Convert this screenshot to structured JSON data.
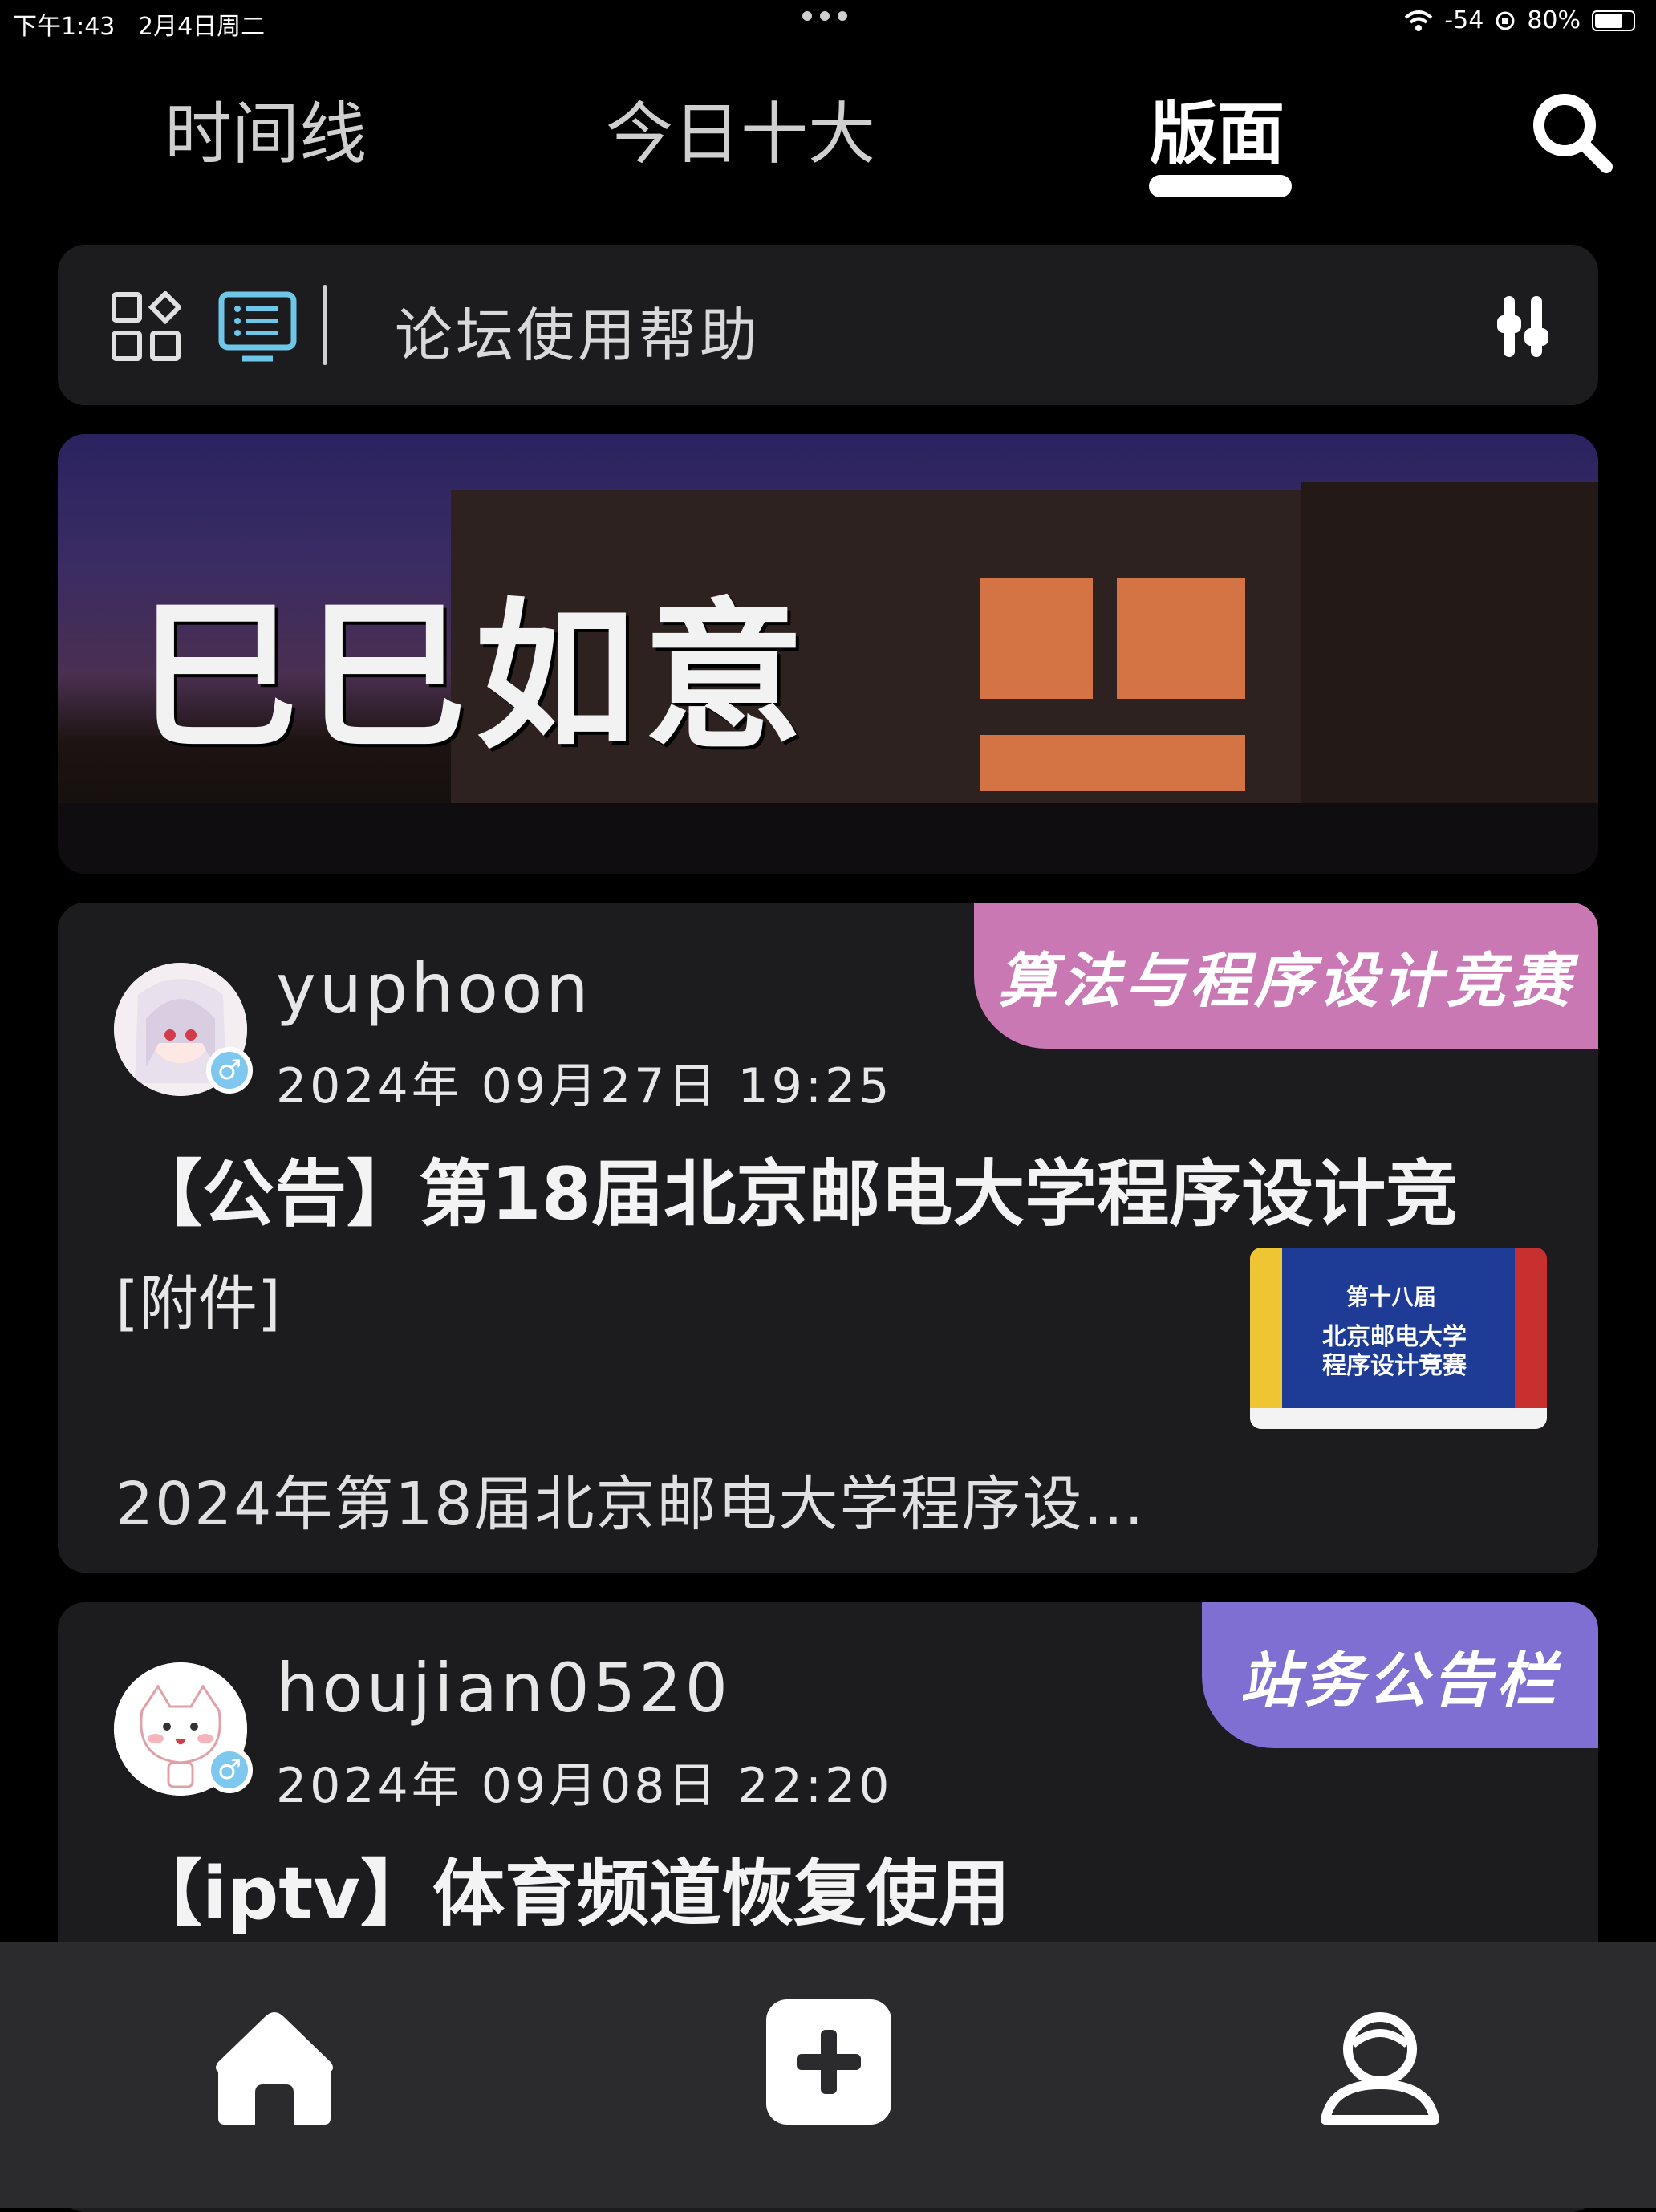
{
  "status_bar": {
    "time": "下午1:43",
    "date": "2月4日周二",
    "signal": "-54",
    "battery": "80%",
    "battery_level": 0.8
  },
  "tabs": [
    {
      "label": "时间线",
      "active": false
    },
    {
      "label": "今日十大",
      "active": false
    },
    {
      "label": "版面",
      "active": true
    }
  ],
  "board_bar": {
    "board_name": "论坛使用帮助",
    "icons": [
      "grid-icon",
      "list-icon",
      "settings-sliders-icon"
    ]
  },
  "banner": {
    "text": "巳巳如意"
  },
  "posts": [
    {
      "username": "yuphoon",
      "datetime": "2024年 09月27日 19:25",
      "board_tag": "算法与程序设计竞赛",
      "tag_color": "#c978b4",
      "title": "【公告】第18届北京邮电大学程序设计竞",
      "attachment_label": "[附件]",
      "thumbnail_text": {
        "line1": "第十八届",
        "line2": "北京邮电大学",
        "line3": "程序设计竞赛"
      },
      "summary": "2024年第18届北京邮电大学程序设..."
    },
    {
      "username": "houjian0520",
      "datetime": "2024年 09月08日 22:20",
      "board_tag": "站务公告栏",
      "tag_color": "#7f6fd2",
      "title": "【iptv】体育频道恢复使用"
    }
  ],
  "bottom_nav": [
    "home-icon",
    "add-icon",
    "profile-icon"
  ],
  "colors": {
    "background": "#000000",
    "card": "#1c1c1e",
    "accent_list_icon": "#6ec6e8",
    "bottom_bar": "#2b2b2d"
  }
}
